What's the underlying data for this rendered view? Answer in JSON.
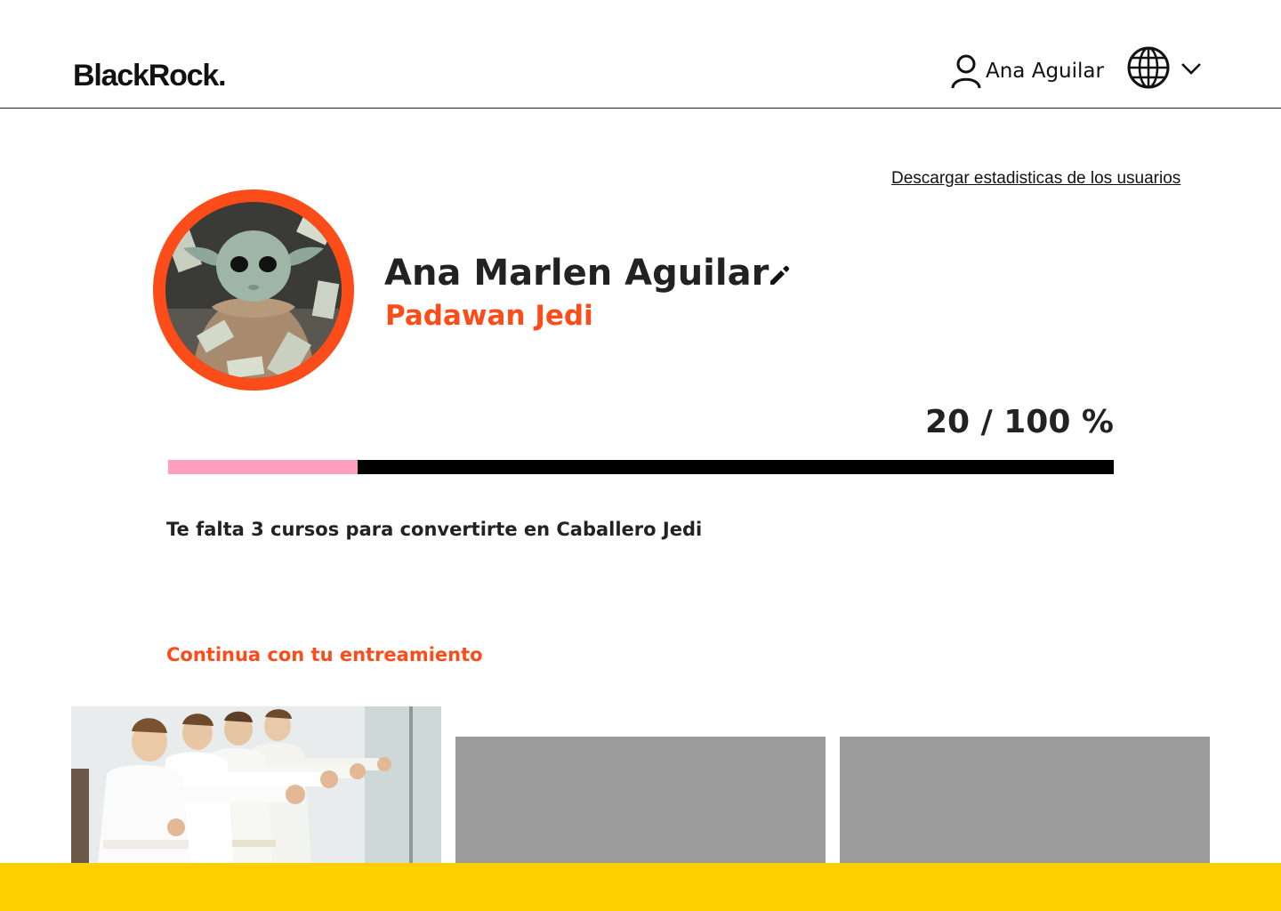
{
  "header": {
    "logo_text": "BlackRock",
    "logo_dot": ".",
    "user_name": "Ana Aguilar",
    "icons": {
      "user": "user-icon",
      "language": "globe-icon",
      "dropdown": "chevron-down-icon"
    }
  },
  "download_link": "Descargar estadisticas de los usuarios",
  "profile": {
    "name": "Ana Marlen Aguilar",
    "rank": "Padawan Jedi",
    "avatar": "avatar-image",
    "edit_icon": "pencil-icon"
  },
  "progress": {
    "label": "20 / 100 %",
    "value": 20,
    "max": 100,
    "fill_color": "#ff9fbf",
    "track_color": "#000000"
  },
  "remaining_text": "Te falta 3 cursos para convertirte en Caballero Jedi",
  "training": {
    "title": "Continua con tu entreamiento",
    "cards": [
      {
        "image": "karate-kids-photo"
      },
      {
        "image": "placeholder"
      },
      {
        "image": "placeholder"
      }
    ]
  },
  "colors": {
    "accent": "#fc4c19",
    "footer": "#ffcf00",
    "placeholder": "#9b9b9b"
  }
}
